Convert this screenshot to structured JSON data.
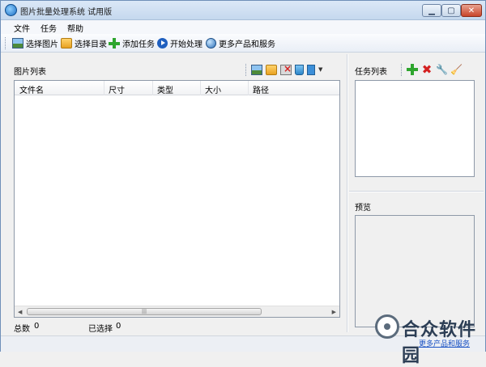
{
  "window": {
    "title": "图片批量处理系统 试用版"
  },
  "menu": {
    "items": [
      "文件",
      "任务",
      "帮助"
    ]
  },
  "toolbar": {
    "items": [
      {
        "label": "选择图片",
        "icon": "image-icon"
      },
      {
        "label": "选择目录",
        "icon": "folder-icon"
      },
      {
        "label": "添加任务",
        "icon": "plus-icon"
      },
      {
        "label": "开始处理",
        "icon": "play-icon"
      },
      {
        "label": "更多产品和服务",
        "icon": "globe-icon"
      }
    ]
  },
  "image_list": {
    "title": "图片列表",
    "columns": [
      "文件名",
      "尺寸",
      "类型",
      "大小",
      "路径"
    ],
    "rows": []
  },
  "task_list": {
    "title": "任务列表"
  },
  "preview": {
    "title": "预览"
  },
  "status": {
    "total_label": "总数",
    "total_value": "0",
    "selected_label": "已选择",
    "selected_value": "0"
  },
  "watermark": {
    "brand": "合众软件园",
    "link_text": "更多产品和服务"
  },
  "colors": {
    "title_bar": "#c5d8ee",
    "close_button": "#c8442a",
    "accent_green": "#2ea52e",
    "accent_red": "#d42020"
  }
}
